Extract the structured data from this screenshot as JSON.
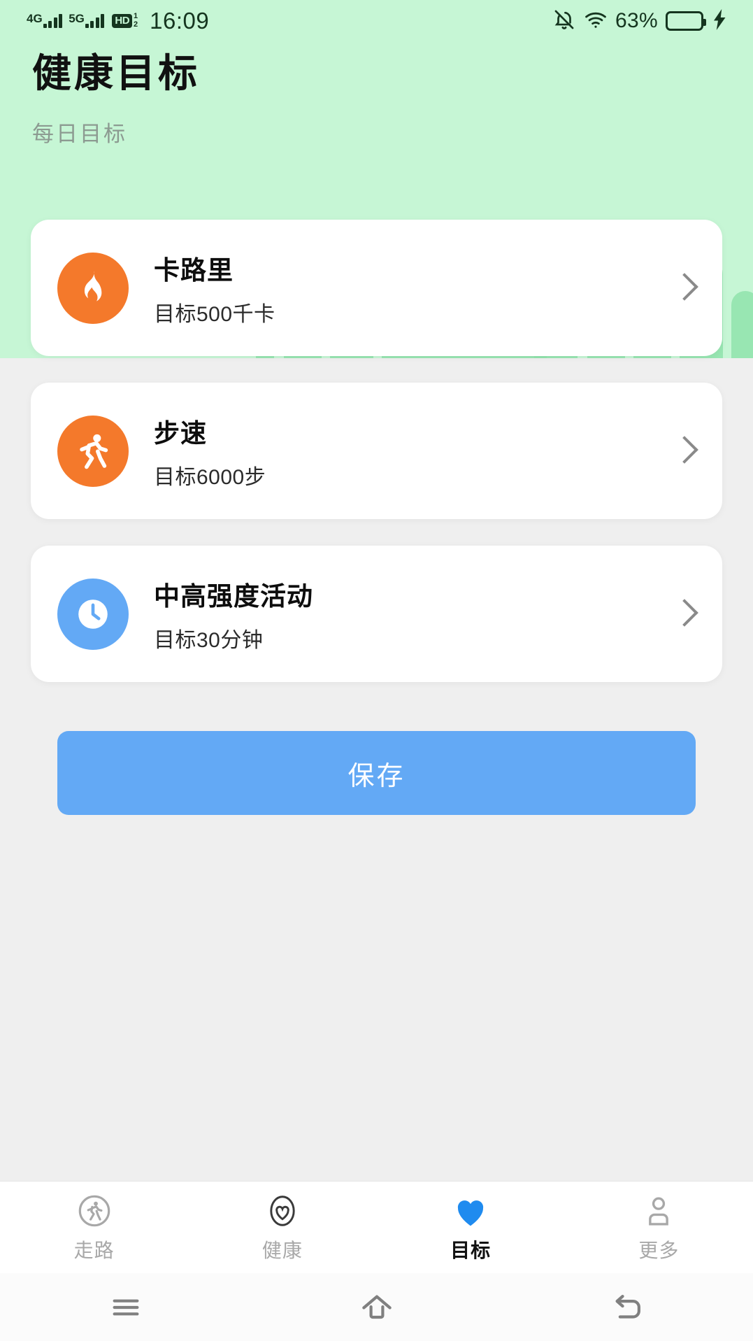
{
  "status_bar": {
    "network_1": "4G",
    "network_2": "5G",
    "hd_label": "HD",
    "hd_sup": "1",
    "hd_sub": "2",
    "time": "16:09",
    "battery_percent": "63%",
    "battery_level": 63,
    "icons": [
      "bell-muted-icon",
      "wifi-icon",
      "battery-icon",
      "charging-bolt-icon"
    ]
  },
  "header": {
    "title": "健康目标",
    "subtitle": "每日目标",
    "background_color": "#c6f6d5",
    "wave_color": "#8fe3ab"
  },
  "goals": [
    {
      "icon": "flame-icon",
      "icon_color": "#f4792b",
      "title": "卡路里",
      "subtitle": "目标500千卡",
      "chevron": "chevron-right-icon"
    },
    {
      "icon": "running-person-icon",
      "icon_color": "#f4792b",
      "title": "步速",
      "subtitle": "目标6000步",
      "chevron": "chevron-right-icon"
    },
    {
      "icon": "clock-icon",
      "icon_color": "#63a9f5",
      "title": "中高强度活动",
      "subtitle": "目标30分钟",
      "chevron": "chevron-right-icon"
    }
  ],
  "save_button": {
    "label": "保存",
    "color": "#63a9f5"
  },
  "tabbar": {
    "active_color": "#1f8bef",
    "items": [
      {
        "icon": "walking-circle-icon",
        "label": "走路",
        "active": false
      },
      {
        "icon": "heart-outline-icon",
        "label": "健康",
        "active": false
      },
      {
        "icon": "heart-filled-icon",
        "label": "目标",
        "active": true
      },
      {
        "icon": "person-outline-icon",
        "label": "更多",
        "active": false
      }
    ]
  },
  "navbar": {
    "items": [
      {
        "icon": "menu-recents-icon",
        "label": "Recents"
      },
      {
        "icon": "home-icon",
        "label": "Home"
      },
      {
        "icon": "back-icon",
        "label": "Back"
      }
    ]
  }
}
